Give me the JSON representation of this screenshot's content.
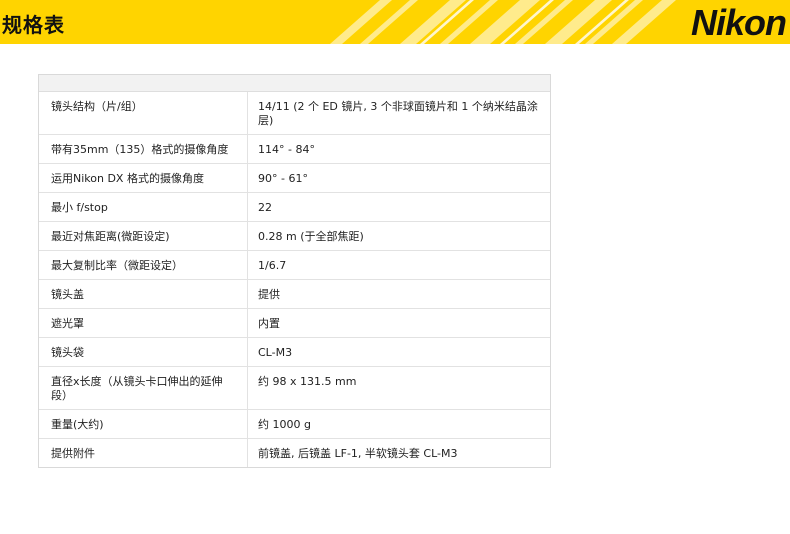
{
  "header": {
    "title": "规格表",
    "logo_text": "Nikon",
    "accent_color": "#ffd400",
    "stripe_color": "#ffffff"
  },
  "specs": [
    {
      "label": "镜头结构（片/组）",
      "value": "14/11 (2 个 ED 镜片, 3 个非球面镜片和 1 个纳米结晶涂层)"
    },
    {
      "label": "带有35mm（135）格式的摄像角度",
      "value": "114° - 84°"
    },
    {
      "label": "运用Nikon DX 格式的摄像角度",
      "value": "90° - 61°"
    },
    {
      "label": "最小 f/stop",
      "value": "22"
    },
    {
      "label": "最近对焦距离(微距设定)",
      "value": "0.28 m (于全部焦距)"
    },
    {
      "label": "最大复制比率（微距设定）",
      "value": "1/6.7"
    },
    {
      "label": "镜头盖",
      "value": "提供"
    },
    {
      "label": "遮光罩",
      "value": "内置"
    },
    {
      "label": "镜头袋",
      "value": "CL-M3"
    },
    {
      "label": "直径x长度（从镜头卡口伸出的延伸段）",
      "value": "约 98 x 131.5 mm"
    },
    {
      "label": "重量(大约)",
      "value": "约 1000 g"
    },
    {
      "label": "提供附件",
      "value": "前镜盖, 后镜盖 LF-1, 半软镜头套 CL-M3"
    }
  ]
}
